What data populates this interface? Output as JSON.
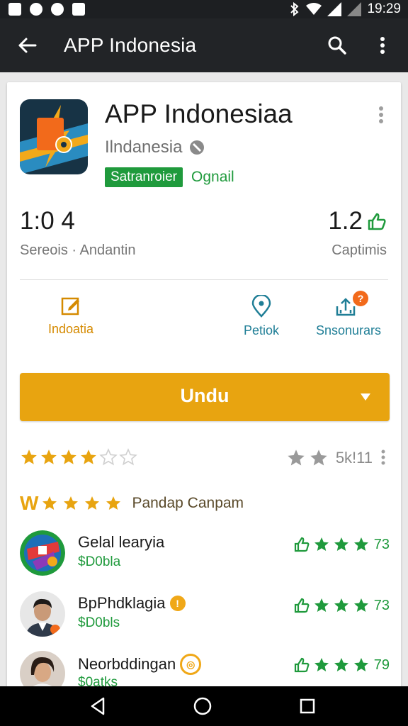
{
  "status_bar": {
    "time": "19:29",
    "left_icons": [
      "gallery-icon",
      "messenger-icon",
      "drop-icon",
      "notification-icon"
    ],
    "right_icons": [
      "bluetooth-icon",
      "wifi-icon",
      "signal-icon",
      "signal-empty-icon"
    ]
  },
  "app_bar": {
    "title": "APP Indonesia",
    "back_icon": "arrow-left-icon",
    "search_icon": "search-icon",
    "more_icon": "more-vertical-icon"
  },
  "app": {
    "name": "APP Indonesiaa",
    "developer": "Ilndanesia",
    "category": "Satranroier",
    "original_label": "Ognail",
    "stats": {
      "left_value": "1:0 4",
      "left_label": "Sereois · Andantin",
      "right_value": "1.2",
      "right_label": "Captimis"
    },
    "actions": [
      {
        "label": "Indoatia",
        "icon": "edit-icon",
        "color": "#d58a00"
      },
      {
        "label": "Petiok",
        "icon": "location-pin-icon",
        "color": "#1f7e96"
      },
      {
        "label": "Snsonurars",
        "icon": "share-icon",
        "color": "#1f7e96",
        "badge": "?"
      }
    ]
  },
  "install": {
    "label": "Undu",
    "dropdown_icon": "chevron-down-icon"
  },
  "rating": {
    "filled_stars": 4,
    "total_stars": 6,
    "right_text": "5k!11",
    "right_stars": 2
  },
  "reviews": {
    "logo_text": "W",
    "title": "Pandap  Canpam",
    "items": [
      {
        "name": "Gelal learyia",
        "sub": "$D0bla",
        "score": "73",
        "verified": false
      },
      {
        "name": "BpPhdklagia",
        "sub": "$D0bls",
        "score": "73",
        "verified": true
      },
      {
        "name": "Neorbddingan",
        "sub": "$0atks",
        "score": "79",
        "verified": true
      }
    ]
  },
  "nav_bar": {
    "back": "nav-back-icon",
    "home": "nav-home-icon",
    "recents": "nav-recents-icon"
  },
  "colors": {
    "install": "#e8a410",
    "green": "#1f9a3c",
    "teal": "#1f7e96",
    "app_bar": "#222427"
  }
}
